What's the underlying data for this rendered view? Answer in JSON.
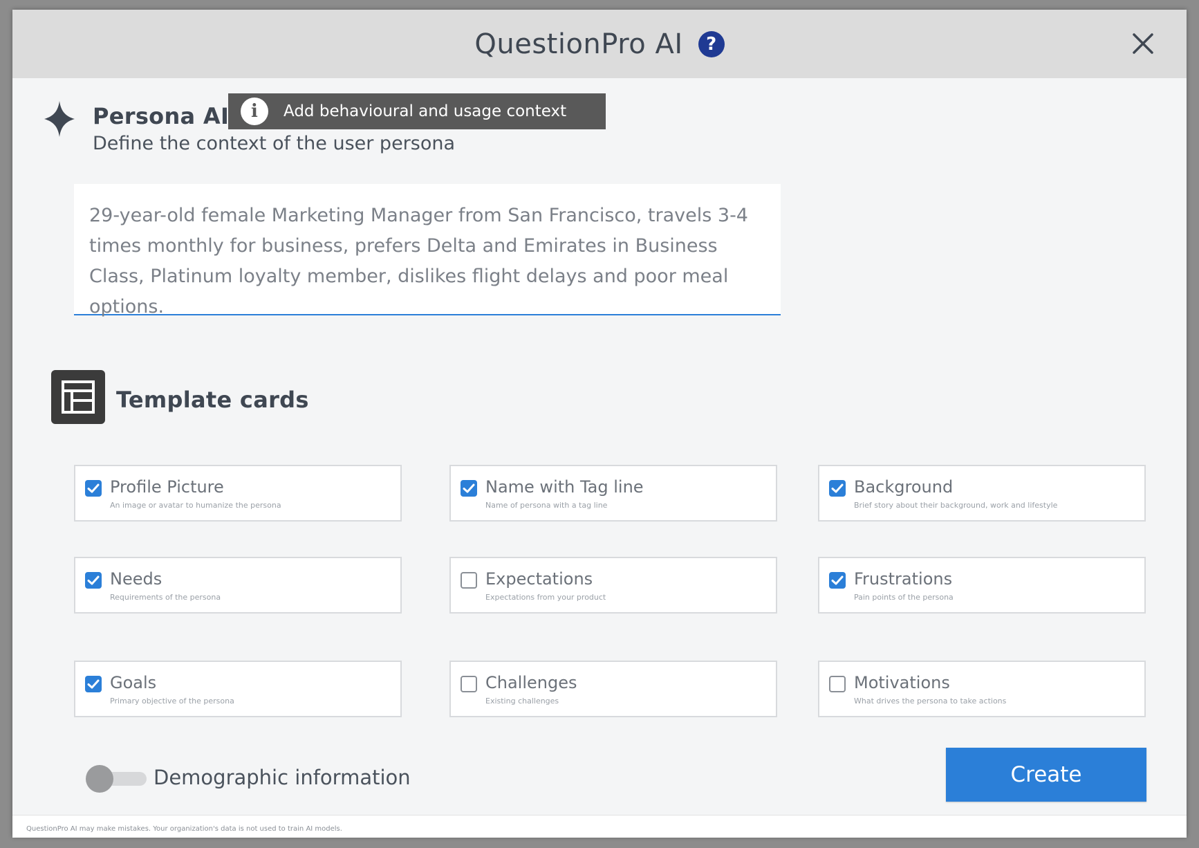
{
  "header": {
    "title": "QuestionPro AI",
    "help_symbol": "?"
  },
  "persona": {
    "title": "Persona AI",
    "subtitle": "Define the context of the user persona",
    "tooltip": "Add behavioural and usage context",
    "info_symbol": "i"
  },
  "context_text": "29-year-old female Marketing Manager from San Francisco, travels 3-4 times monthly for business, prefers Delta and Emirates in Business Class, Platinum loyalty member, dislikes flight delays and poor meal options.",
  "template": {
    "title": "Template cards",
    "cards": [
      {
        "label": "Profile Picture",
        "desc": "An image or avatar to humanize the persona",
        "checked": true
      },
      {
        "label": "Name with Tag line",
        "desc": "Name of persona with a tag line",
        "checked": true
      },
      {
        "label": "Background",
        "desc": "Brief story about their background, work and lifestyle",
        "checked": true
      },
      {
        "label": "Needs",
        "desc": "Requirements of the persona",
        "checked": true
      },
      {
        "label": "Expectations",
        "desc": "Expectations from your product",
        "checked": false
      },
      {
        "label": "Frustrations",
        "desc": "Pain points of the persona",
        "checked": true
      },
      {
        "label": "Goals",
        "desc": "Primary objective of the persona",
        "checked": true
      },
      {
        "label": "Challenges",
        "desc": "Existing challenges",
        "checked": false
      },
      {
        "label": "Motivations",
        "desc": "What drives the persona to take actions",
        "checked": false
      }
    ]
  },
  "demographic": {
    "label": "Demographic information",
    "enabled": false
  },
  "create_label": "Create",
  "footer_text": "QuestionPro AI may make mistakes. Your organization's data is not used to train AI models.",
  "colors": {
    "accent": "#2b7fd8",
    "help_icon": "#1f3a93",
    "tooltip_bg": "#595959",
    "header_bg": "#dcdcdc"
  },
  "icons": {
    "help": "question-circle-icon",
    "close": "close-icon",
    "spark": "sparkle-icon",
    "info": "info-icon",
    "template": "template-layout-icon"
  }
}
